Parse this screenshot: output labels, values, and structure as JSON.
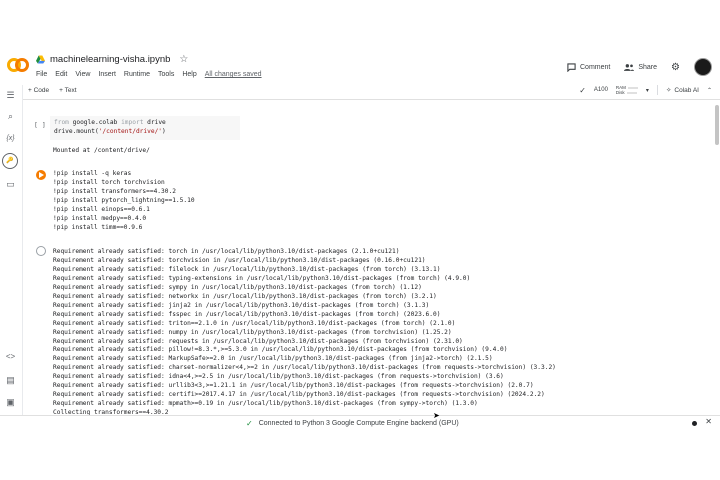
{
  "app": {
    "logo": "CO",
    "notebook_title": "machinelearning-visha.ipynb",
    "menu": [
      "File",
      "Edit",
      "View",
      "Insert",
      "Runtime",
      "Tools",
      "Help"
    ],
    "save_status": "All changes saved",
    "comment_label": "Comment",
    "share_label": "Share"
  },
  "toolbar": {
    "add_code": "+ Code",
    "add_text": "+ Text",
    "runtime": "A100",
    "ram_label": "RAM",
    "disk_label": "Disk",
    "colab_ai": "Colab AI"
  },
  "cells": {
    "cell1": {
      "bracket": "[ ]",
      "line1_a": "from",
      "line1_b": " google.colab ",
      "line1_c": "import",
      "line1_d": " drive",
      "line2_a": "drive.mount(",
      "line2_b": "'/content/drive/'",
      "line2_c": ")",
      "output": "Mounted at /content/drive/"
    },
    "cell2": {
      "lines": [
        "!pip install -q keras",
        "!pip install torch torchvision",
        "!pip install transformers==4.30.2",
        "!pip install pytorch_lightning==1.5.10",
        "!pip install einops==0.6.1",
        "!pip install medpy==0.4.0",
        "!pip install timm==0.9.6"
      ]
    },
    "output_lines": [
      "Requirement already satisfied: torch in /usr/local/lib/python3.10/dist-packages (2.1.0+cu121)",
      "Requirement already satisfied: torchvision in /usr/local/lib/python3.10/dist-packages (0.16.0+cu121)",
      "Requirement already satisfied: filelock in /usr/local/lib/python3.10/dist-packages (from torch) (3.13.1)",
      "Requirement already satisfied: typing-extensions in /usr/local/lib/python3.10/dist-packages (from torch) (4.9.0)",
      "Requirement already satisfied: sympy in /usr/local/lib/python3.10/dist-packages (from torch) (1.12)",
      "Requirement already satisfied: networkx in /usr/local/lib/python3.10/dist-packages (from torch) (3.2.1)",
      "Requirement already satisfied: jinja2 in /usr/local/lib/python3.10/dist-packages (from torch) (3.1.3)",
      "Requirement already satisfied: fsspec in /usr/local/lib/python3.10/dist-packages (from torch) (2023.6.0)",
      "Requirement already satisfied: triton==2.1.0 in /usr/local/lib/python3.10/dist-packages (from torch) (2.1.0)",
      "Requirement already satisfied: numpy in /usr/local/lib/python3.10/dist-packages (from torchvision) (1.25.2)",
      "Requirement already satisfied: requests in /usr/local/lib/python3.10/dist-packages (from torchvision) (2.31.0)",
      "Requirement already satisfied: pillow!=8.3.*,>=5.3.0 in /usr/local/lib/python3.10/dist-packages (from torchvision) (9.4.0)",
      "Requirement already satisfied: MarkupSafe>=2.0 in /usr/local/lib/python3.10/dist-packages (from jinja2->torch) (2.1.5)",
      "Requirement already satisfied: charset-normalizer<4,>=2 in /usr/local/lib/python3.10/dist-packages (from requests->torchvision) (3.3.2)",
      "Requirement already satisfied: idna<4,>=2.5 in /usr/local/lib/python3.10/dist-packages (from requests->torchvision) (3.6)",
      "Requirement already satisfied: urllib3<3,>=1.21.1 in /usr/local/lib/python3.10/dist-packages (from requests->torchvision) (2.0.7)",
      "Requirement already satisfied: certifi>=2017.4.17 in /usr/local/lib/python3.10/dist-packages (from requests->torchvision) (2024.2.2)",
      "Requirement already satisfied: mpmath>=0.19 in /usr/local/lib/python3.10/dist-packages (from sympy->torch) (1.3.0)",
      "Collecting transformers==4.30.2"
    ]
  },
  "status": {
    "message": "Connected to Python 3 Google Compute Engine backend (GPU)",
    "close": "✕"
  },
  "colors": {
    "accent": "#f9ab00",
    "run_button": "#f57c00",
    "status_ok": "#1e8e3e"
  }
}
